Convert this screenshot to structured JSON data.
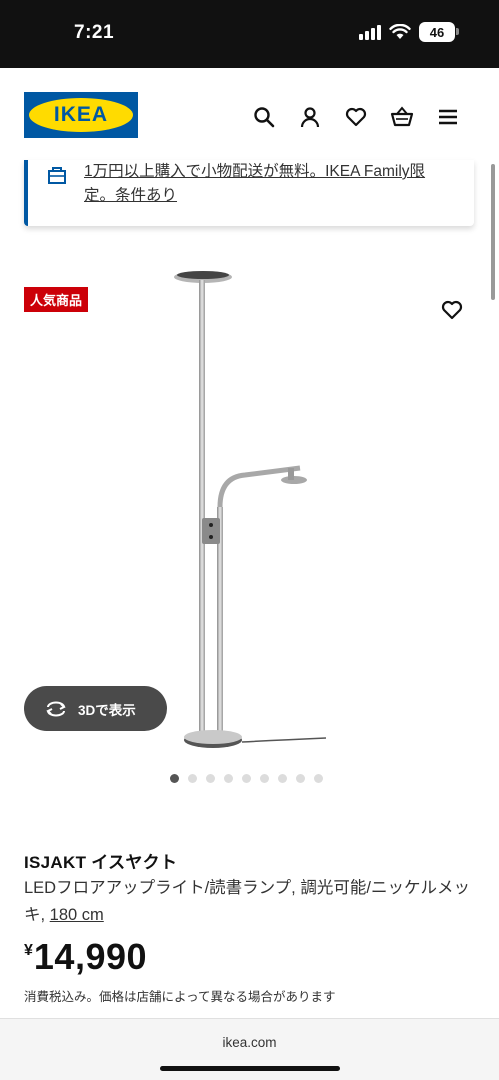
{
  "status_bar": {
    "time": "7:21",
    "battery": "46"
  },
  "header": {
    "logo_text": "IKEA",
    "icons": [
      "search-icon",
      "user-icon",
      "heart-icon",
      "basket-icon",
      "menu-icon"
    ]
  },
  "banner": {
    "text": "1万円以上購入で小物配送が無料。IKEA Family限定。条件あり",
    "icon": "shop-icon"
  },
  "product": {
    "badge": "人気商品",
    "view_3d_label": "3Dで表示",
    "gallery": {
      "count": 9,
      "active_index": 0
    },
    "name": "ISJAKT イスヤクト",
    "description": "LEDフロアアップライト/読書ランプ, 調光可能/ニッケルメッキ, ",
    "size": "180 cm",
    "price_currency": "¥",
    "price": "14,990",
    "tax_note": "消費税込み。価格は店舗によって異なる場合があります"
  },
  "browser": {
    "url": "ikea.com"
  },
  "colors": {
    "ikea_blue": "#0058a3",
    "ikea_yellow": "#ffdb00",
    "badge_red": "#cc0008"
  }
}
